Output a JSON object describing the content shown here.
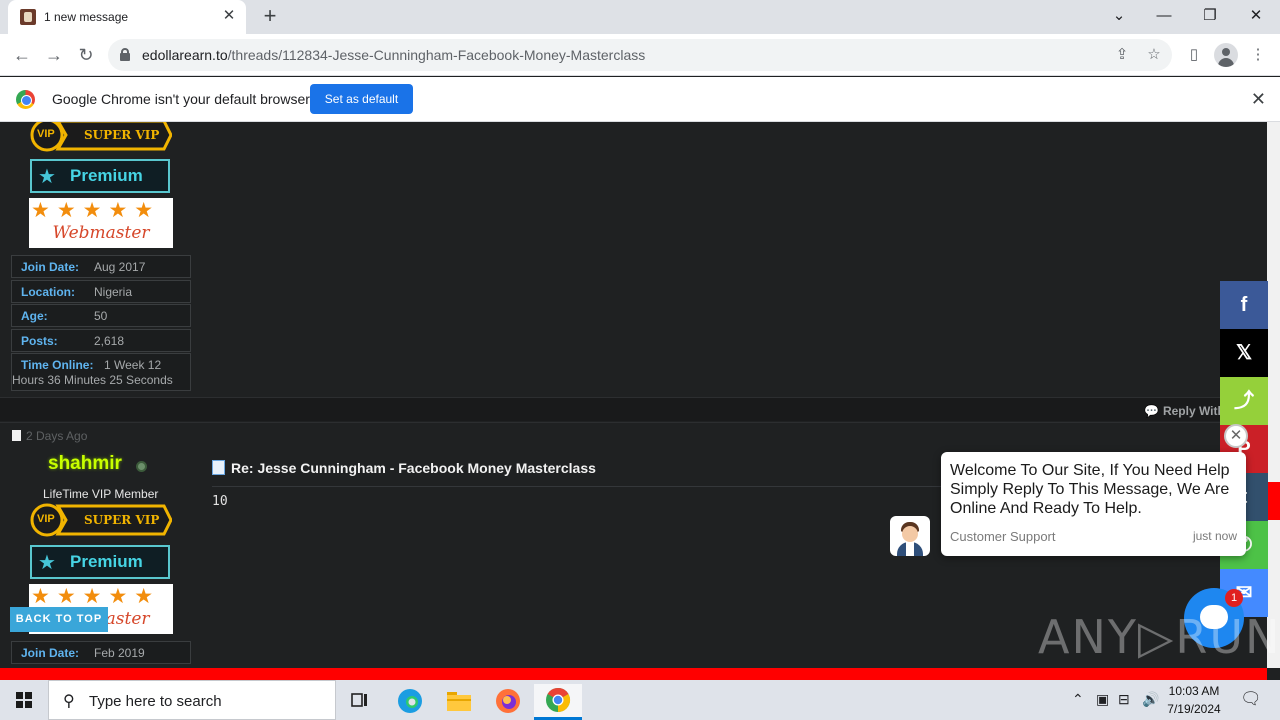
{
  "browser": {
    "tab_title": "1 new message",
    "tab_close": "✕",
    "new_tab": "+",
    "window_controls": {
      "dropdown": "⌄",
      "minimize": "—",
      "restore": "❐",
      "close": "✕"
    },
    "url_host": "edollarearn.to",
    "url_path": "/threads/112834-Jesse-Cunningham-Facebook-Money-Masterclass",
    "infobar_text": "Google Chrome isn't your default browser",
    "set_default_label": "Set as default",
    "infobar_close": "✕"
  },
  "post1": {
    "badges": {
      "vip_label": "SUPER VIP",
      "vip_circle": "VIP",
      "premium_label": "Premium",
      "webmaster_label": "Webmaster",
      "stars": "★★★★★"
    },
    "info": [
      {
        "key": "Join Date:",
        "value": "Aug 2017"
      },
      {
        "key": "Location:",
        "value": "Nigeria"
      },
      {
        "key": "Age:",
        "value": "50"
      },
      {
        "key": "Posts:",
        "value": "2,618"
      }
    ],
    "time_online": {
      "key": "Time Online:",
      "value_line1": "1 Week 12",
      "value_line2": "Hours 36 Minutes 25 Seconds"
    },
    "reply_with": "Reply With"
  },
  "post2": {
    "date": "2 Days Ago",
    "username": "shahmir",
    "user_title": "LifeTime VIP Member",
    "title": "Re: Jesse Cunningham - Facebook Money Masterclass",
    "body": "10",
    "badges": {
      "vip_label": "SUPER VIP",
      "vip_circle": "VIP",
      "premium_label": "Premium",
      "webmaster_label": "Webmaster",
      "stars": "★★★★★"
    },
    "info": [
      {
        "key": "Join Date:",
        "value": "Feb 2019"
      }
    ]
  },
  "back_to_top": "BACK TO TOP",
  "share": {
    "facebook": "f",
    "x": "𝕏",
    "share": "⤴",
    "pinterest": "P",
    "tumblr": "t",
    "whatsapp": "✆",
    "messenger": "✉",
    "colors": {
      "facebook": "#3b5998",
      "x": "#000000",
      "share": "#95d03a",
      "pinterest": "#cb2027",
      "tumblr": "#32506d",
      "whatsapp": "#4dc247",
      "messenger": "#448aff"
    }
  },
  "chat": {
    "message": "Welcome To Our Site, If You Need Help Simply Reply To This Message, We Are Online And Ready To Help.",
    "sender": "Customer Support",
    "time": "just now",
    "unread_count": "1",
    "close": "✕"
  },
  "watermark": "ANY▷RUN",
  "taskbar": {
    "search_placeholder": "Type here to search",
    "time": "10:03 AM",
    "date": "7/19/2024"
  }
}
